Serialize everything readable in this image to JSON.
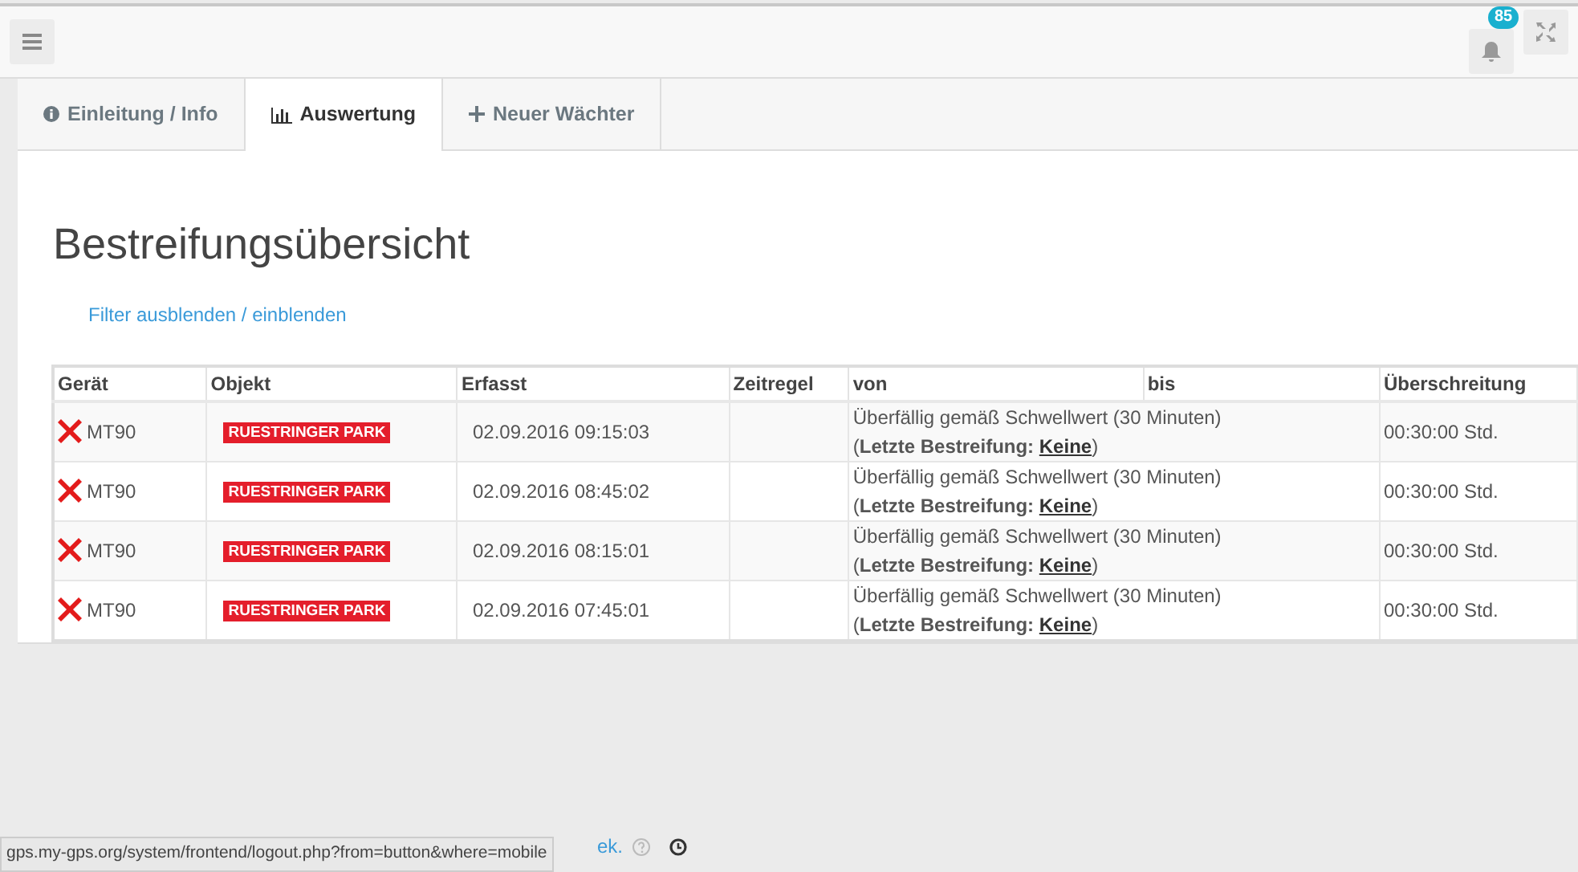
{
  "topbar": {
    "notification_count": "85"
  },
  "tabs": [
    {
      "label": "Einleitung / Info",
      "kind": "info",
      "selected": false
    },
    {
      "label": "Auswertung",
      "kind": "chart",
      "selected": true
    },
    {
      "label": "Neuer Wächter",
      "kind": "plus",
      "selected": false
    }
  ],
  "title": "Bestreifungsübersicht",
  "filter": {
    "hide": "Filter ausblenden",
    "separator": "/",
    "show": "einblenden"
  },
  "table": {
    "columns": [
      "Gerät",
      "Objekt",
      "Erfasst",
      "Zeitregel",
      "von",
      "bis",
      "Überschreitung"
    ],
    "rows": [
      {
        "alert": true,
        "device": "MT90",
        "object": "RUESTRINGER PARK",
        "captured": "02.09.2016 09:15:03",
        "message": "Überfällig gemäß Schwellwert (30 Minuten)",
        "last": {
          "prefix": "(",
          "label": "Letzte Bestreifung:",
          "link": "Keine",
          "suffix": ")"
        },
        "exceeded": "00:30:00 Std."
      },
      {
        "alert": true,
        "device": "MT90",
        "object": "RUESTRINGER PARK",
        "captured": "02.09.2016 08:45:02",
        "message": "Überfällig gemäß Schwellwert (30 Minuten)",
        "last": {
          "prefix": "(",
          "label": "Letzte Bestreifung:",
          "link": "Keine",
          "suffix": ")"
        },
        "exceeded": "00:30:00 Std."
      },
      {
        "alert": true,
        "device": "MT90",
        "object": "RUESTRINGER PARK",
        "captured": "02.09.2016 08:15:01",
        "message": "Überfällig gemäß Schwellwert (30 Minuten)",
        "last": {
          "prefix": "(",
          "label": "Letzte Bestreifung:",
          "link": "Keine",
          "suffix": ")"
        },
        "exceeded": "00:30:00 Std."
      },
      {
        "alert": true,
        "device": "MT90",
        "object": "RUESTRINGER PARK",
        "captured": "02.09.2016 07:45:01",
        "message": "Überfällig gemäß Schwellwert (30 Minuten)",
        "last": {
          "prefix": "(",
          "label": "Letzte Bestreifung:",
          "link": "Keine",
          "suffix": ")"
        },
        "exceeded": "00:30:00 Std."
      }
    ]
  },
  "footer": {
    "text": "ek."
  },
  "status_url": "gps.my-gps.org/system/frontend/logout.php?from=button&where=mobile"
}
